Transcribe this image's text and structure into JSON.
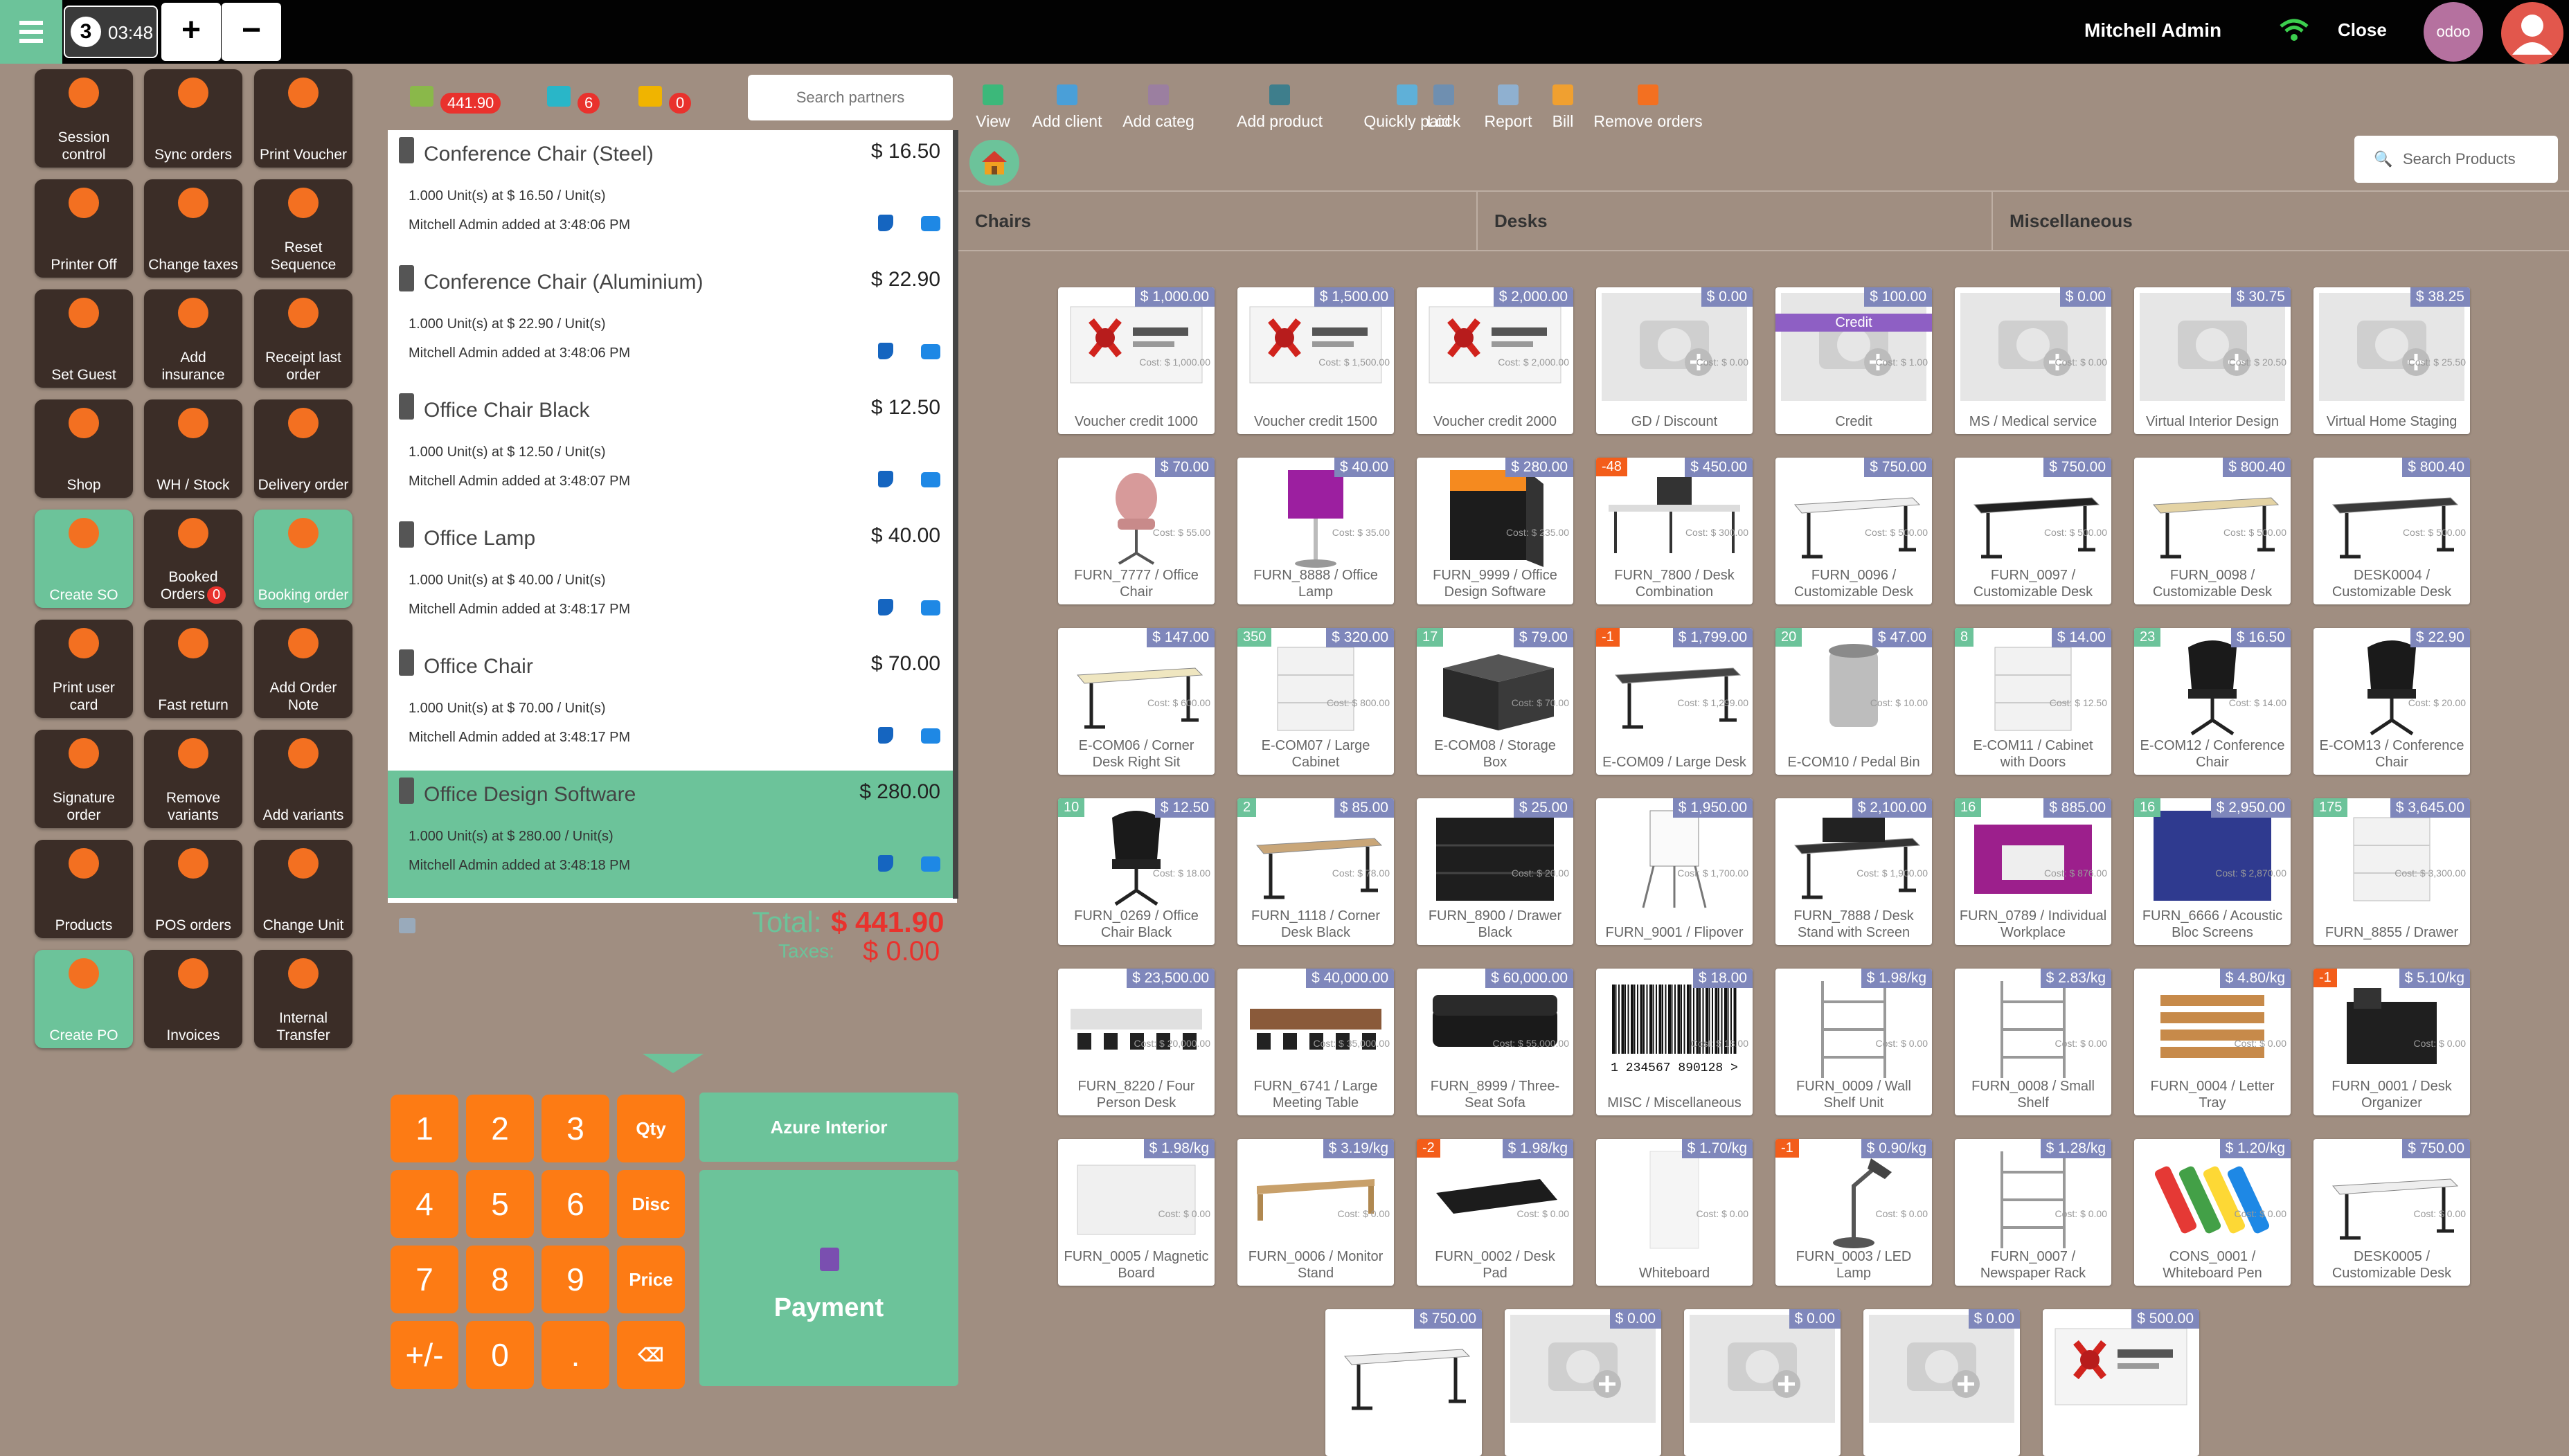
{
  "header": {
    "order_number": "3",
    "order_time": "03:48",
    "add_order_label": "+",
    "remove_order_label": "−",
    "user_name": "Mitchell Admin",
    "close_label": "Close",
    "brand_logo_text": "odoo"
  },
  "tiles": [
    {
      "name": "session-control",
      "label": "Session control",
      "icon": "cash-register-icon",
      "color": "#3b2d27"
    },
    {
      "name": "sync-orders",
      "label": "Sync orders",
      "icon": "sync-icon",
      "color": "#3b2d27"
    },
    {
      "name": "print-voucher",
      "label": "Print Voucher",
      "icon": "voucher-icon",
      "color": "#3b2d27"
    },
    {
      "name": "printer-off",
      "label": "Printer Off",
      "icon": "printer-icon",
      "color": "#3b2d27"
    },
    {
      "name": "change-taxes",
      "label": "Change taxes",
      "icon": "tax-icon",
      "color": "#3b2d27"
    },
    {
      "name": "reset-sequence",
      "label": "Reset Sequence",
      "icon": "reset-icon",
      "color": "#3b2d27"
    },
    {
      "name": "set-guest",
      "label": "Set Guest",
      "icon": "guests-icon",
      "color": "#3b2d27"
    },
    {
      "name": "add-insurance",
      "label": "Add insurance",
      "icon": "insurance-icon",
      "color": "#3b2d27"
    },
    {
      "name": "receipt-last-order",
      "label": "Receipt last order",
      "icon": "receipt-icon",
      "color": "#3b2d27"
    },
    {
      "name": "shop",
      "label": "Shop",
      "icon": "shop-icon",
      "color": "#3b2d27"
    },
    {
      "name": "wh-store",
      "label": "WH / Stock",
      "icon": "warehouse-icon",
      "color": "#3b2d27"
    },
    {
      "name": "delivery-order",
      "label": "Delivery order",
      "icon": "delivery-icon",
      "color": "#3b2d27"
    },
    {
      "name": "create-so",
      "label": "Create SO",
      "icon": "cart-icon",
      "color": "#6cc39a"
    },
    {
      "name": "booked-orders",
      "label": "Booked Orders",
      "badge": "0",
      "icon": "booked-icon",
      "color": "#3b2d27"
    },
    {
      "name": "booking-order",
      "label": "Booking order",
      "icon": "booking-icon",
      "color": "#6cc39a"
    },
    {
      "name": "print-user-card",
      "label": "Print user card",
      "icon": "user-card-icon",
      "color": "#3b2d27"
    },
    {
      "name": "fast-return",
      "label": "Fast return",
      "icon": "return-icon",
      "color": "#3b2d27"
    },
    {
      "name": "add-order-note",
      "label": "Add Order Note",
      "icon": "note-icon",
      "color": "#3b2d27"
    },
    {
      "name": "signature-order",
      "label": "Signature order",
      "icon": "signature-icon",
      "color": "#3b2d27"
    },
    {
      "name": "remove-variants",
      "label": "Remove variants",
      "icon": "trash-icon",
      "color": "#3b2d27"
    },
    {
      "name": "add-variants",
      "label": "Add variants",
      "icon": "variants-icon",
      "color": "#3b2d27"
    },
    {
      "name": "products",
      "label": "Products",
      "icon": "products-icon",
      "color": "#3b2d27"
    },
    {
      "name": "pos-orders",
      "label": "POS orders",
      "icon": "orders-icon",
      "color": "#3b2d27"
    },
    {
      "name": "change-unit",
      "label": "Change Unit",
      "icon": "unit-icon",
      "color": "#3b2d27"
    },
    {
      "name": "create-po",
      "label": "Create PO",
      "icon": "basket-icon",
      "color": "#6cc39a"
    },
    {
      "name": "invoices",
      "label": "Invoices",
      "icon": "invoices-icon",
      "color": "#3b2d27"
    },
    {
      "name": "internal-transfer",
      "label": "Internal Transfer",
      "icon": "truck-icon",
      "color": "#3b2d27"
    }
  ],
  "stats": {
    "amount": "441.90",
    "cart_count": "6",
    "gift_count": "0"
  },
  "partner_search": {
    "placeholder": "Search partners"
  },
  "toolbar": [
    {
      "name": "view",
      "label": "View",
      "color": "#3cb87a"
    },
    {
      "name": "add-client",
      "label": "Add client",
      "color": "#4a9fd8"
    },
    {
      "name": "add-categ",
      "label": "Add categ",
      "color": "#9b7fa0"
    },
    {
      "name": "add-product",
      "label": "Add product",
      "color": "#3e7e8c"
    },
    {
      "name": "quickly-paid",
      "label": "Quickly paid",
      "color": "#5fb0d8"
    },
    {
      "name": "lock",
      "label": "Lock",
      "color": "#6f8fb0"
    },
    {
      "name": "report",
      "label": "Report",
      "color": "#8fb0d0"
    },
    {
      "name": "bill",
      "label": "Bill",
      "color": "#f0a030"
    },
    {
      "name": "remove-orders",
      "label": "Remove orders",
      "color": "#f37021"
    }
  ],
  "order_lines": [
    {
      "name": "Conference Chair (Steel)",
      "price": "$ 16.50",
      "qty": "1.000 Unit(s) at $ 16.50 / Unit(s)",
      "added": "Mitchell Admin added at 3:48:06 PM"
    },
    {
      "name": "Conference Chair (Aluminium)",
      "price": "$ 22.90",
      "qty": "1.000 Unit(s) at $ 22.90 / Unit(s)",
      "added": "Mitchell Admin added at 3:48:06 PM"
    },
    {
      "name": "Office Chair Black",
      "price": "$ 12.50",
      "qty": "1.000 Unit(s) at $ 12.50 / Unit(s)",
      "added": "Mitchell Admin added at 3:48:07 PM"
    },
    {
      "name": "Office Lamp",
      "price": "$ 40.00",
      "qty": "1.000 Unit(s) at $ 40.00 / Unit(s)",
      "added": "Mitchell Admin added at 3:48:17 PM"
    },
    {
      "name": "Office Chair",
      "price": "$ 70.00",
      "qty": "1.000 Unit(s) at $ 70.00 / Unit(s)",
      "added": "Mitchell Admin added at 3:48:17 PM"
    },
    {
      "name": "Office Design Software",
      "price": "$ 280.00",
      "qty": "1.000 Unit(s) at $ 280.00 / Unit(s)",
      "added": "Mitchell Admin added at 3:48:18 PM"
    }
  ],
  "summary": {
    "total_label": "Total:",
    "total_value": "$ 441.90",
    "taxes_label": "Taxes:",
    "taxes_value": "$ 0.00"
  },
  "numpad": [
    "1",
    "2",
    "3",
    "Qty",
    "4",
    "5",
    "6",
    "Disc",
    "7",
    "8",
    "9",
    "Price",
    "+/-",
    "0",
    ".",
    "⌫"
  ],
  "customer_label": "Azure Interior",
  "payment_label": "Payment",
  "product_search": {
    "placeholder": "Search Products"
  },
  "categories": [
    "Chairs",
    "Desks",
    "Miscellaneous"
  ],
  "products": [
    {
      "name": "Voucher credit 1000",
      "price": "$ 1,000.00",
      "cost": "Cost: $ 1,000.00",
      "img": "voucher"
    },
    {
      "name": "Voucher credit 1500",
      "price": "$ 1,500.00",
      "cost": "Cost: $ 1,500.00",
      "img": "voucher"
    },
    {
      "name": "Voucher credit 2000",
      "price": "$ 2,000.00",
      "cost": "Cost: $ 2,000.00",
      "img": "voucher"
    },
    {
      "name": "GD / Discount",
      "price": "$ 0.00",
      "cost": "Cost: $ 0.00",
      "img": "placeholder"
    },
    {
      "name": "Credit",
      "price": "$ 100.00",
      "cost": "Cost: $ 1.00",
      "img": "placeholder",
      "ribbon": "Credit"
    },
    {
      "name": "MS / Medical service",
      "price": "$ 0.00",
      "cost": "Cost: $ 0.00",
      "img": "placeholder"
    },
    {
      "name": "Virtual Interior Design",
      "price": "$ 30.75",
      "cost": "Cost: $ 20.50",
      "img": "placeholder"
    },
    {
      "name": "Virtual Home Staging",
      "price": "$ 38.25",
      "cost": "Cost: $ 25.50",
      "img": "placeholder"
    },
    {
      "name": "FURN_7777 / Office Chair",
      "price": "$ 70.00",
      "cost": "Cost: $ 55.00",
      "img": "chair-pink"
    },
    {
      "name": "FURN_8888 / Office Lamp",
      "price": "$ 40.00",
      "cost": "Cost: $ 35.00",
      "img": "lamp"
    },
    {
      "name": "FURN_9999 / Office Design Software",
      "price": "$ 280.00",
      "cost": "Cost: $ 235.00",
      "img": "software"
    },
    {
      "name": "FURN_7800 / Desk Combination",
      "price": "$ 450.00",
      "cost": "Cost: $ 300.00",
      "img": "desk-combo",
      "qty": "-48"
    },
    {
      "name": "FURN_0096 / Customizable Desk",
      "price": "$ 750.00",
      "cost": "Cost: $ 500.00",
      "img": "desk-white"
    },
    {
      "name": "FURN_0097 / Customizable Desk",
      "price": "$ 750.00",
      "cost": "Cost: $ 500.00",
      "img": "desk-black"
    },
    {
      "name": "FURN_0098 / Customizable Desk",
      "price": "$ 800.40",
      "cost": "Cost: $ 500.00",
      "img": "desk-wood"
    },
    {
      "name": "DESK0004 / Customizable Desk",
      "price": "$ 800.40",
      "cost": "Cost: $ 500.00",
      "img": "desk-dark"
    },
    {
      "name": "E-COM06 / Corner Desk Right Sit",
      "price": "$ 147.00",
      "cost": "Cost: $ 600.00",
      "img": "desk-corner"
    },
    {
      "name": "E-COM07 / Large Cabinet",
      "price": "$ 320.00",
      "cost": "Cost: $ 800.00",
      "img": "cabinet",
      "qty": "350"
    },
    {
      "name": "E-COM08 / Storage Box",
      "price": "$ 79.00",
      "cost": "Cost: $ 70.00",
      "img": "box",
      "qty": "17"
    },
    {
      "name": "E-COM09 / Large Desk",
      "price": "$ 1,799.00",
      "cost": "Cost: $ 1,299.00",
      "img": "desk-large",
      "qty": "-1"
    },
    {
      "name": "E-COM10 / Pedal Bin",
      "price": "$ 47.00",
      "cost": "Cost: $ 10.00",
      "img": "bin",
      "qty": "20"
    },
    {
      "name": "E-COM11 / Cabinet with Doors",
      "price": "$ 14.00",
      "cost": "Cost: $ 12.50",
      "img": "cabinet-doors",
      "qty": "8"
    },
    {
      "name": "E-COM12 / Conference Chair",
      "price": "$ 16.50",
      "cost": "Cost: $ 14.00",
      "img": "chair-black",
      "qty": "23"
    },
    {
      "name": "E-COM13 / Conference Chair",
      "price": "$ 22.90",
      "cost": "Cost: $ 20.00",
      "img": "chair-black"
    },
    {
      "name": "FURN_0269 / Office Chair Black",
      "price": "$ 12.50",
      "cost": "Cost: $ 18.00",
      "img": "chair-office",
      "qty": "10"
    },
    {
      "name": "FURN_1118 / Corner Desk Black",
      "price": "$ 85.00",
      "cost": "Cost: $ 78.00",
      "img": "desk-corner-black",
      "qty": "2"
    },
    {
      "name": "FURN_8900 / Drawer Black",
      "price": "$ 25.00",
      "cost": "Cost: $ 20.00",
      "img": "drawer-black"
    },
    {
      "name": "FURN_9001 / Flipover",
      "price": "$ 1,950.00",
      "cost": "Cost: $ 1,700.00",
      "img": "flipover"
    },
    {
      "name": "FURN_7888 / Desk Stand with Screen",
      "price": "$ 2,100.00",
      "cost": "Cost: $ 1,900.00",
      "img": "desk-screen"
    },
    {
      "name": "FURN_0789 / Individual Workplace",
      "price": "$ 885.00",
      "cost": "Cost: $ 876.00",
      "img": "workplace",
      "qty": "16"
    },
    {
      "name": "FURN_6666 / Acoustic Bloc Screens",
      "price": "$ 2,950.00",
      "cost": "Cost: $ 2,870.00",
      "img": "screens",
      "qty": "16"
    },
    {
      "name": "FURN_8855 / Drawer",
      "price": "$ 3,645.00",
      "cost": "Cost: $ 3,300.00",
      "img": "drawer-white",
      "qty": "175"
    },
    {
      "name": "FURN_8220 / Four Person Desk",
      "price": "$ 23,500.00",
      "cost": "Cost: $ 20,000.00",
      "img": "four-desk"
    },
    {
      "name": "FURN_6741 / Large Meeting Table",
      "price": "$ 40,000.00",
      "cost": "Cost: $ 35,000.00",
      "img": "meeting-table"
    },
    {
      "name": "FURN_8999 / Three-Seat Sofa",
      "price": "$ 60,000.00",
      "cost": "Cost: $ 55,000.00",
      "img": "sofa"
    },
    {
      "name": "MISC / Miscellaneous",
      "price": "$ 18.00",
      "cost": "Cost: $ 18.00",
      "img": "barcode",
      "barcode": "1 234567 890128 >"
    },
    {
      "name": "FURN_0009 / Wall Shelf Unit",
      "price": "$ 1.98/kg",
      "cost": "Cost: $ 0.00",
      "img": "shelf"
    },
    {
      "name": "FURN_0008 / Small Shelf",
      "price": "$ 2.83/kg",
      "cost": "Cost: $ 0.00",
      "img": "small-shelf"
    },
    {
      "name": "FURN_0004 / Letter Tray",
      "price": "$ 4.80/kg",
      "cost": "Cost: $ 0.00",
      "img": "tray"
    },
    {
      "name": "FURN_0001 / Desk Organizer",
      "price": "$ 5.10/kg",
      "cost": "Cost: $ 0.00",
      "img": "organizer",
      "qty": "-1"
    },
    {
      "name": "FURN_0005 / Magnetic Board",
      "price": "$ 1.98/kg",
      "cost": "Cost: $ 0.00",
      "img": "board"
    },
    {
      "name": "FURN_0006 / Monitor Stand",
      "price": "$ 3.19/kg",
      "cost": "Cost: $ 0.00",
      "img": "monitor-stand"
    },
    {
      "name": "FURN_0002 / Desk Pad",
      "price": "$ 1.98/kg",
      "cost": "Cost: $ 0.00",
      "img": "desk-pad",
      "qty": "-2"
    },
    {
      "name": "Whiteboard",
      "price": "$ 1.70/kg",
      "cost": "Cost: $ 0.00",
      "img": "whiteboard"
    },
    {
      "name": "FURN_0003 / LED Lamp",
      "price": "$ 0.90/kg",
      "cost": "Cost: $ 0.00",
      "img": "led-lamp",
      "qty": "-1"
    },
    {
      "name": "FURN_0007 / Newspaper Rack",
      "price": "$ 1.28/kg",
      "cost": "Cost: $ 0.00",
      "img": "rack"
    },
    {
      "name": "CONS_0001 / Whiteboard Pen",
      "price": "$ 1.20/kg",
      "cost": "Cost: $ 0.00",
      "img": "pens"
    },
    {
      "name": "DESK0005 / Customizable Desk",
      "price": "$ 750.00",
      "cost": "Cost: $ 0.00",
      "img": "desk-white"
    },
    {
      "name": "",
      "price": "$ 750.00",
      "cost": "",
      "img": "desk-white"
    },
    {
      "name": "",
      "price": "$ 0.00",
      "cost": "",
      "img": "placeholder"
    },
    {
      "name": "",
      "price": "$ 0.00",
      "cost": "",
      "img": "placeholder"
    },
    {
      "name": "",
      "price": "$ 0.00",
      "cost": "",
      "img": "placeholder"
    },
    {
      "name": "",
      "price": "$ 500.00",
      "cost": "",
      "img": "voucher"
    }
  ],
  "colors": {
    "accent": "#6cc39a",
    "tile_dark": "#3b2d27",
    "numpad": "#fd7b14",
    "price_badge": "#7f87bb",
    "danger": "#e9322d",
    "background": "#a08e81"
  }
}
